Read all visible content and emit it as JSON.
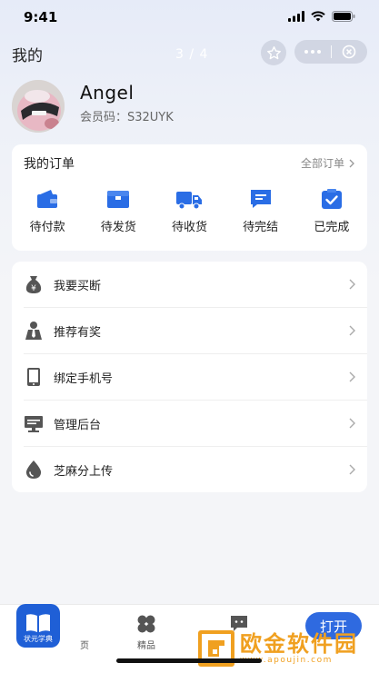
{
  "status_bar": {
    "time": "9:41"
  },
  "nav": {
    "title": "我的",
    "page_indicator": "3 / 4"
  },
  "user": {
    "name": "Angel",
    "member_code": "会员码：S32UYK"
  },
  "orders": {
    "header": "我的订单",
    "all_label": "全部订单",
    "items": [
      {
        "label": "待付款",
        "icon": "wallet-icon"
      },
      {
        "label": "待发货",
        "icon": "box-icon"
      },
      {
        "label": "待收货",
        "icon": "truck-icon"
      },
      {
        "label": "待完结",
        "icon": "message-icon"
      },
      {
        "label": "已完成",
        "icon": "checklist-icon"
      }
    ]
  },
  "menu": [
    {
      "label": "我要买断",
      "icon": "money-bag-icon"
    },
    {
      "label": "推荐有奖",
      "icon": "person-icon"
    },
    {
      "label": "绑定手机号",
      "icon": "phone-icon"
    },
    {
      "label": "管理后台",
      "icon": "monitor-icon"
    },
    {
      "label": "芝麻分上传",
      "icon": "drop-icon"
    }
  ],
  "tab_bar": {
    "app_badge_label": "状元学典",
    "home_label": "页",
    "featured_label": "精品",
    "open_button": "打开"
  },
  "watermark": {
    "cn": "欧金软件园",
    "url": "www.apoujin.com"
  },
  "colors": {
    "accent": "#2f6ae0",
    "icon_blue": "#2a6de5",
    "badge": "#1f5fd6",
    "watermark": "#f0a020"
  }
}
